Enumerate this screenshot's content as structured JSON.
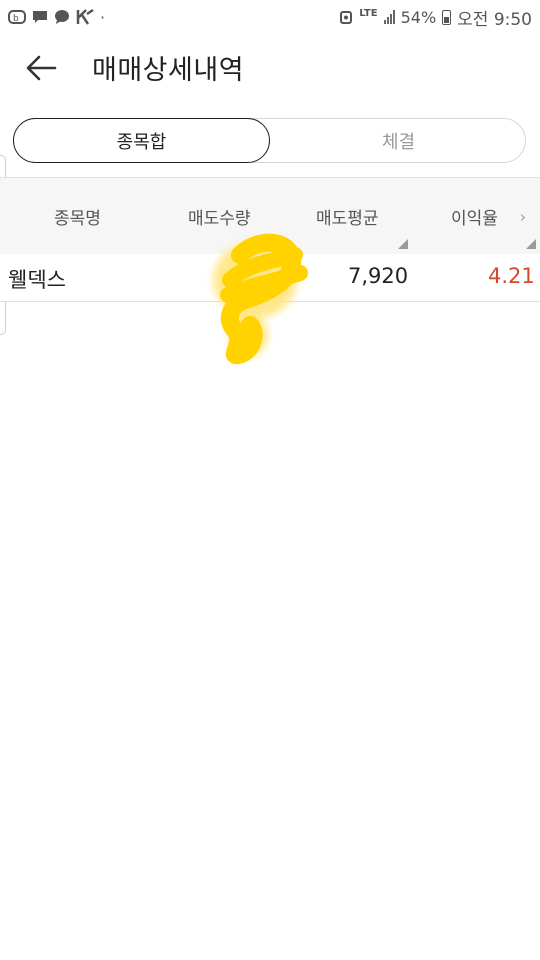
{
  "status_bar": {
    "network": "LTE",
    "battery": "54%",
    "time": "오전 9:50"
  },
  "header": {
    "title": "매매상세내역",
    "back_icon": "arrow-left-icon"
  },
  "tabs": [
    {
      "label": "종목합",
      "active": true
    },
    {
      "label": "체결",
      "active": false
    }
  ],
  "table": {
    "columns": [
      "종목명",
      "매도수량",
      "매도평균",
      "이익율"
    ],
    "rows": [
      {
        "name": "웰덱스",
        "qty": "",
        "avg_price": "7,920",
        "profit_rate": "4.21"
      }
    ]
  },
  "colors": {
    "profit": "#d24a2a",
    "header_bg": "#f6f6f6",
    "highlight": "#ffd200"
  }
}
